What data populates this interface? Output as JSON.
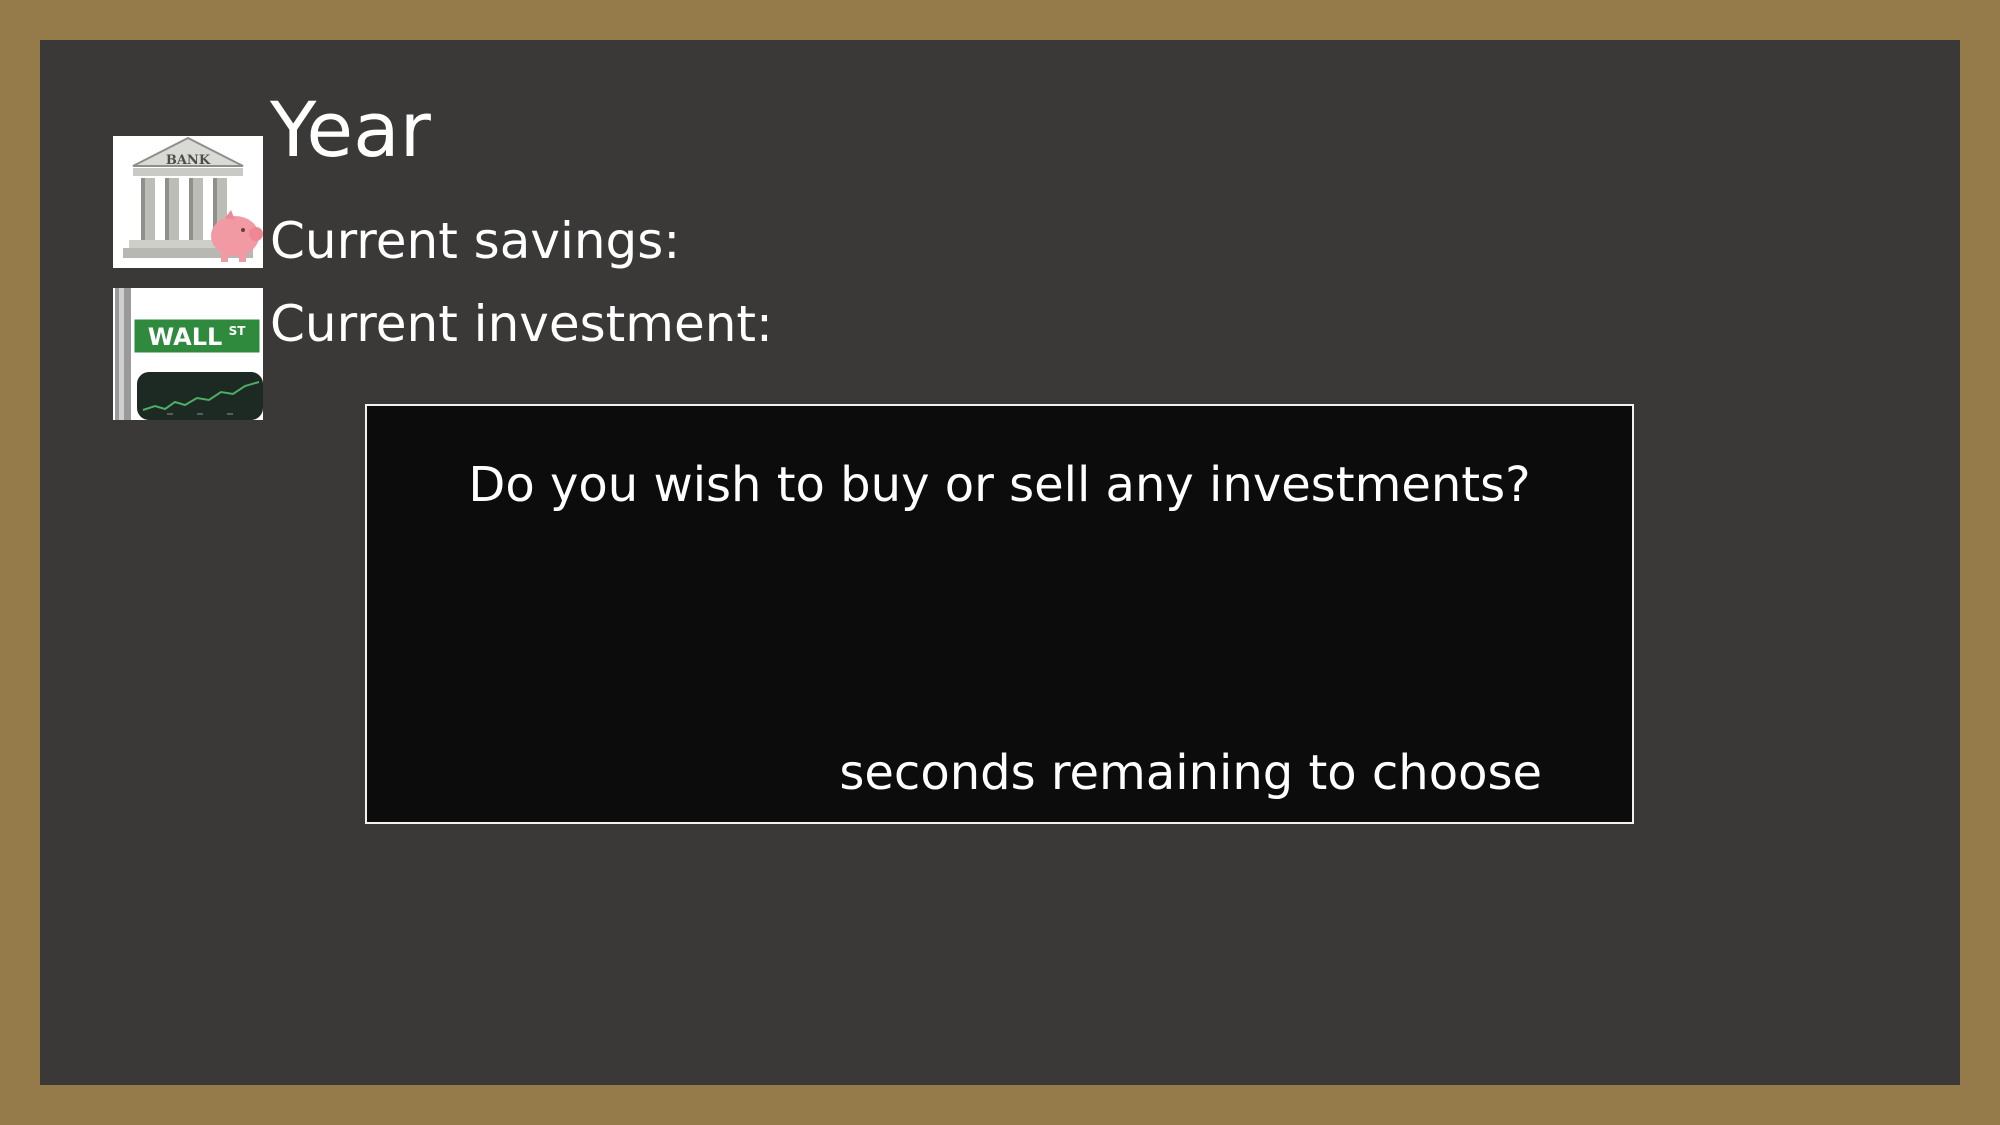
{
  "slide": {
    "title": "Year",
    "savings_label": "Current savings:",
    "investment_label": "Current investment:"
  },
  "icons": {
    "bank": {
      "name": "bank-building-icon",
      "text": "BANK"
    },
    "wallst": {
      "name": "wall-street-sign-icon",
      "text": "WALL",
      "superscript": "ST"
    }
  },
  "dialog": {
    "question": "Do you wish to buy or sell any investments?",
    "timer_label": "seconds remaining to choose"
  },
  "colors": {
    "frame": "#957b49",
    "panel": "#3a3938",
    "dialog_bg": "#0c0c0c",
    "text": "#ffffff",
    "street_sign": "#2f8a3e",
    "piggy": "#f29aa4"
  }
}
